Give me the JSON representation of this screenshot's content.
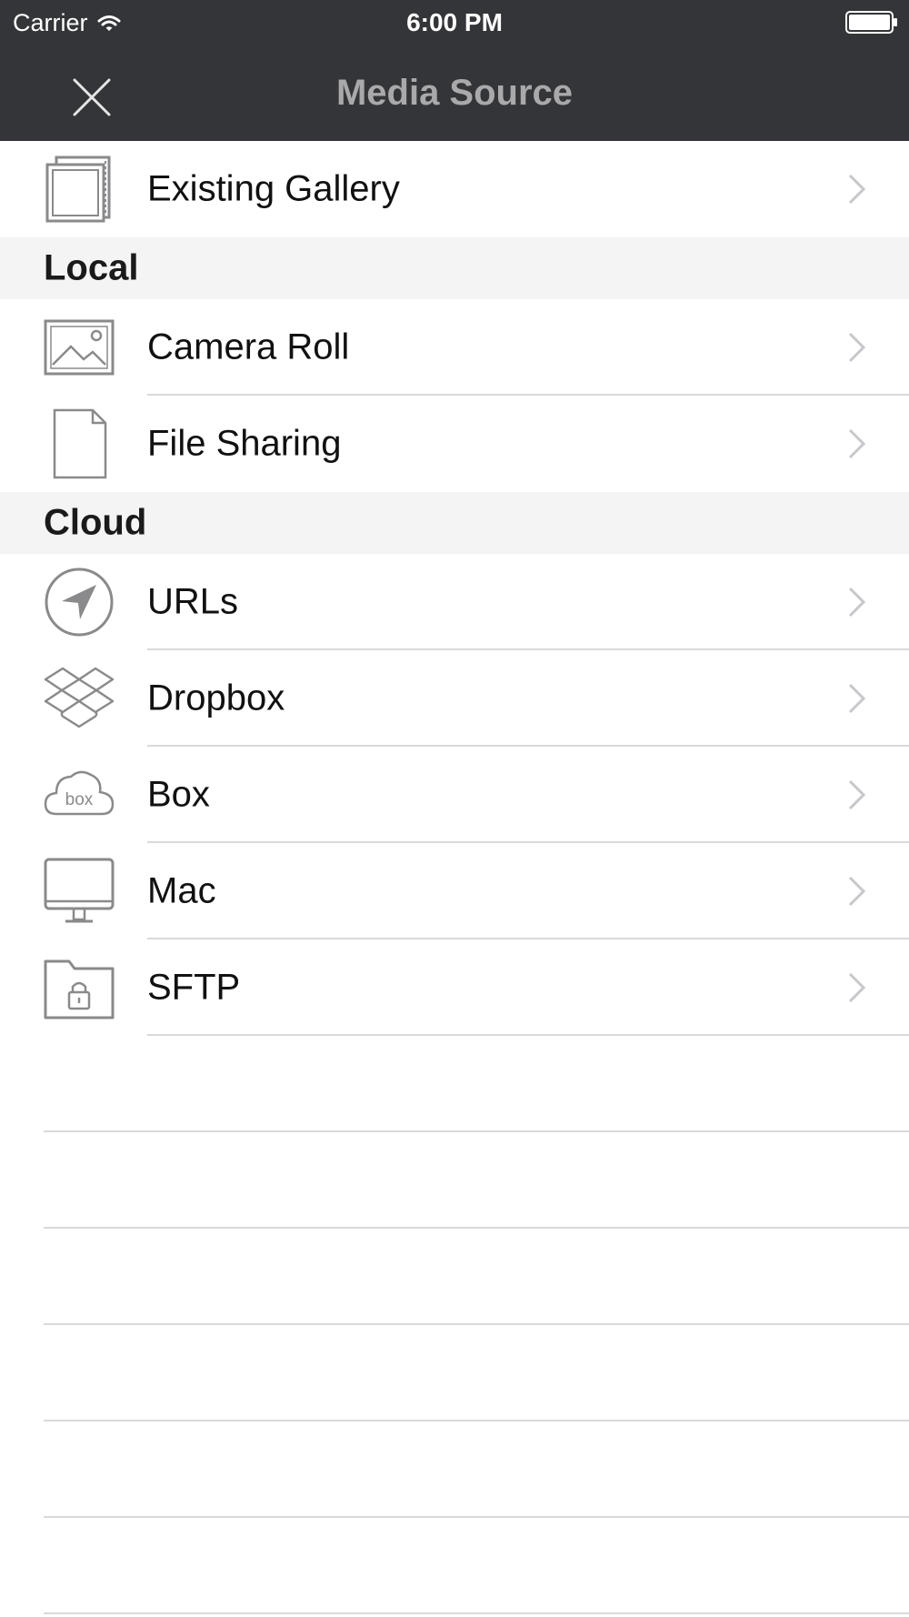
{
  "status_bar": {
    "carrier": "Carrier",
    "time": "6:00 PM"
  },
  "nav": {
    "title": "Media Source",
    "close_icon": "close-icon"
  },
  "top_item": {
    "label": "Existing Gallery",
    "icon": "gallery-icon"
  },
  "sections": {
    "local": {
      "title": "Local",
      "items": [
        {
          "label": "Camera Roll",
          "icon": "photo-icon"
        },
        {
          "label": "File Sharing",
          "icon": "document-icon"
        }
      ]
    },
    "cloud": {
      "title": "Cloud",
      "items": [
        {
          "label": "URLs",
          "icon": "location-arrow-icon"
        },
        {
          "label": "Dropbox",
          "icon": "dropbox-icon"
        },
        {
          "label": "Box",
          "icon": "box-cloud-icon"
        },
        {
          "label": "Mac",
          "icon": "monitor-icon"
        },
        {
          "label": "SFTP",
          "icon": "lock-folder-icon"
        }
      ]
    }
  },
  "colors": {
    "header_bg": "#343538",
    "title": "#a9a9ab",
    "icon": "#8a8a8c",
    "section_bg": "#f4f4f5",
    "separator": "#d9d9db"
  }
}
